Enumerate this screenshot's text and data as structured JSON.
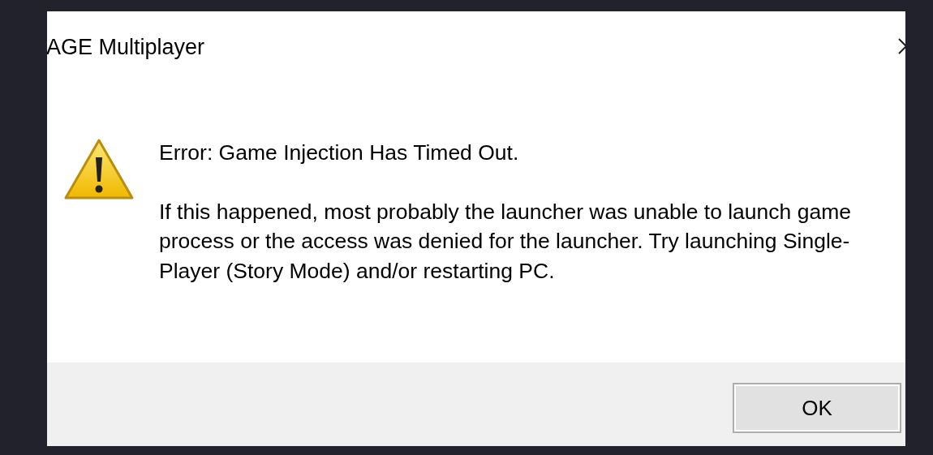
{
  "window": {
    "title": "AGE Multiplayer"
  },
  "message": {
    "heading": "Error: Game Injection Has Timed Out.",
    "body": "If this happened, most probably the launcher was unable to launch game process or the access was denied for the launcher. Try launching Single-Player (Story Mode) and/or restarting PC."
  },
  "buttons": [
    {
      "label": "OK"
    }
  ]
}
